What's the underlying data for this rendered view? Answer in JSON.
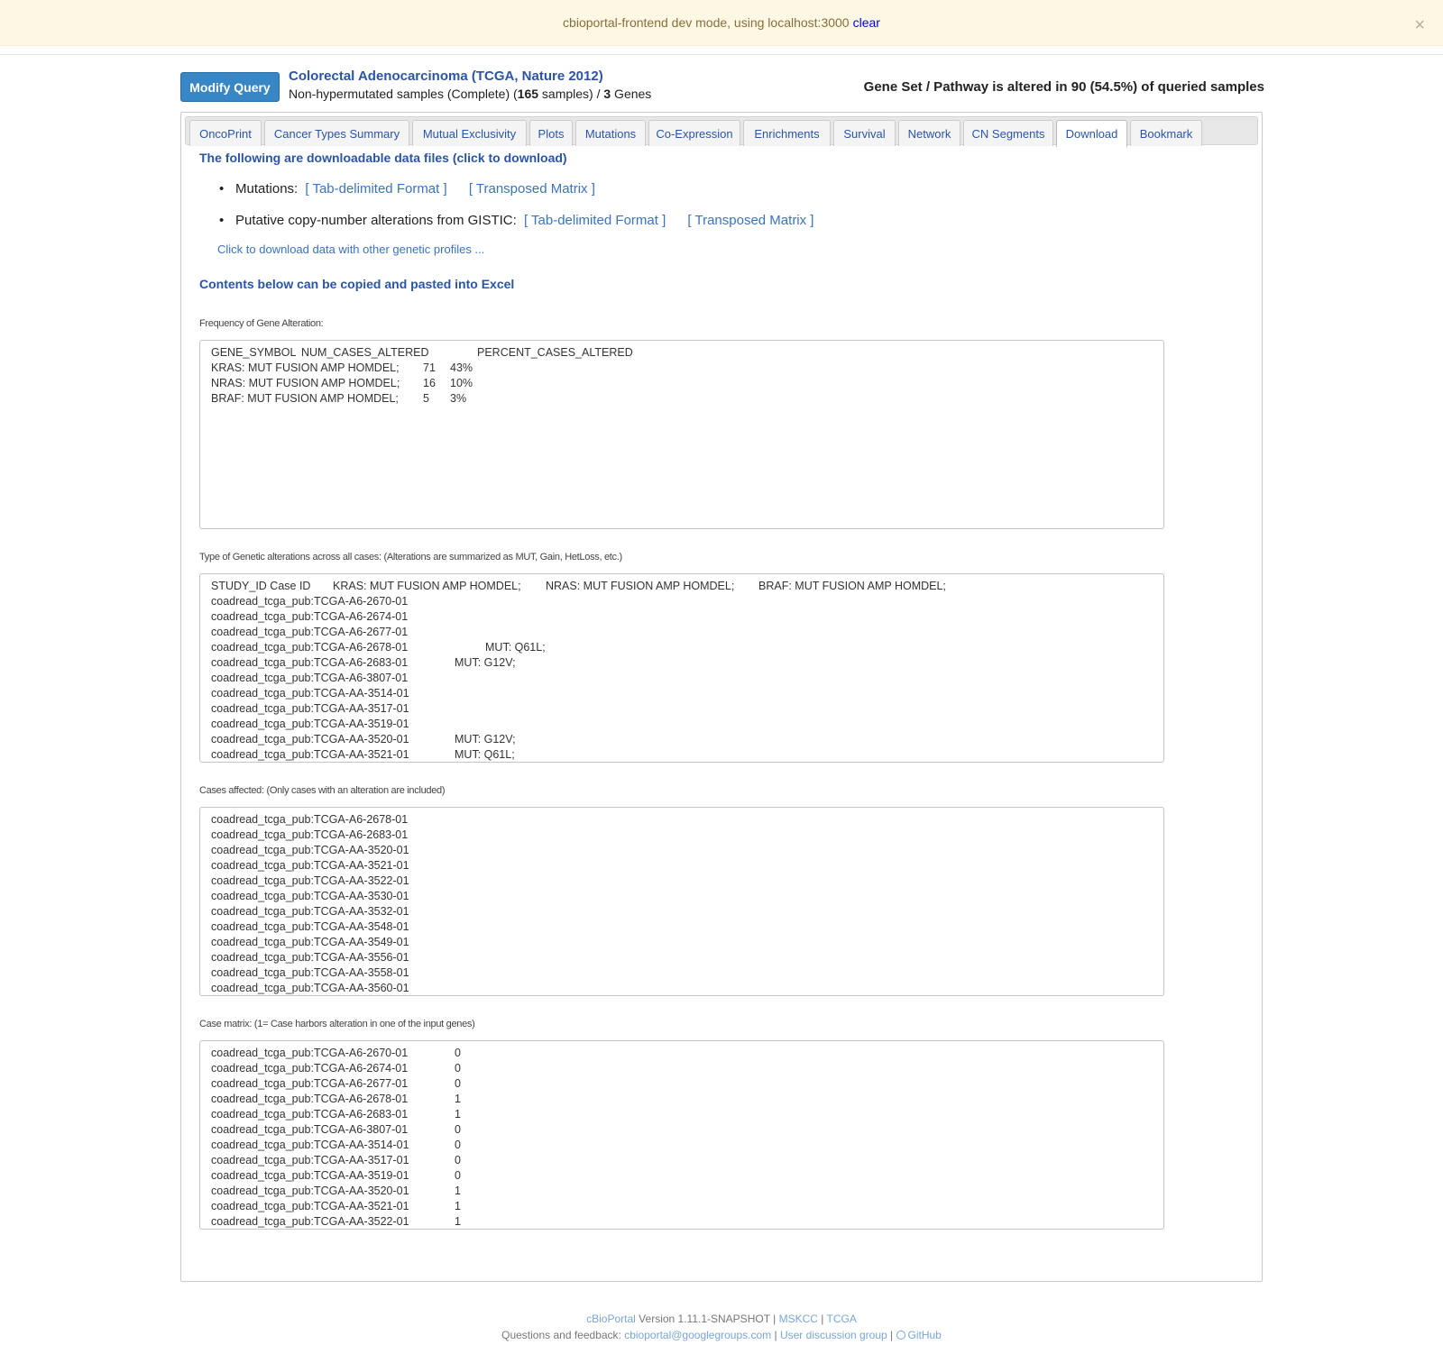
{
  "dev_banner": {
    "text": "cbioportal-frontend dev mode, using localhost:3000",
    "clear_label": "clear",
    "close_symbol": "×"
  },
  "header": {
    "modify_query_label": "Modify Query",
    "study_title": "Colorectal Adenocarcinoma (TCGA, Nature 2012)",
    "study_sub_prefix": "Non-hypermutated samples (Complete)  (",
    "sample_count": "165",
    "study_sub_middle": " samples) / ",
    "gene_count": "3",
    "study_sub_suffix": " Genes",
    "altered_summary": "Gene Set / Pathway is altered in 90 (54.5%) of queried samples"
  },
  "tabs": [
    {
      "label": "OncoPrint"
    },
    {
      "label": "Cancer Types Summary"
    },
    {
      "label": "Mutual Exclusivity"
    },
    {
      "label": "Plots"
    },
    {
      "label": "Mutations"
    },
    {
      "label": "Co-Expression"
    },
    {
      "label": "Enrichments"
    },
    {
      "label": "Survival"
    },
    {
      "label": "Network"
    },
    {
      "label": "CN Segments"
    },
    {
      "label": "Download",
      "active": true
    },
    {
      "label": "Bookmark"
    }
  ],
  "downloads": {
    "title": "The following are downloadable data files (click to download)",
    "items": [
      {
        "label": "Mutations:",
        "tab_link": "[ Tab-delimited Format ]",
        "matrix_link": "[ Transposed Matrix ]"
      },
      {
        "label": "Putative copy-number alterations from GISTIC:",
        "tab_link": "[ Tab-delimited Format ]",
        "matrix_link": "[ Transposed Matrix ]"
      }
    ],
    "other_profiles_link": "Click to download data with other genetic profiles ..."
  },
  "excel": {
    "title": "Contents below can be copied and pasted into Excel",
    "frequency": {
      "label": "Frequency of Gene Alteration:",
      "header": [
        "GENE_SYMBOL",
        "NUM_CASES_ALTERED",
        "PERCENT_CASES_ALTERED"
      ],
      "rows": [
        [
          "KRAS: MUT FUSION AMP HOMDEL;",
          "71",
          "43%"
        ],
        [
          "NRAS: MUT FUSION AMP HOMDEL;",
          "16",
          "10%"
        ],
        [
          "BRAF: MUT FUSION AMP HOMDEL;",
          "5",
          "3%"
        ]
      ]
    },
    "alteration_types": {
      "label": "Type of Genetic alterations across all cases: (Alterations are summarized as MUT, Gain, HetLoss, etc.)",
      "header": [
        "STUDY_ID Case ID",
        "KRAS: MUT FUSION AMP HOMDEL;",
        "NRAS: MUT FUSION AMP HOMDEL;",
        "BRAF: MUT FUSION AMP HOMDEL;"
      ],
      "rows": [
        [
          "coadread_tcga_pub:TCGA-A6-2670-01",
          "",
          "",
          ""
        ],
        [
          "coadread_tcga_pub:TCGA-A6-2674-01",
          "",
          "",
          ""
        ],
        [
          "coadread_tcga_pub:TCGA-A6-2677-01",
          "",
          "",
          ""
        ],
        [
          "coadread_tcga_pub:TCGA-A6-2678-01",
          "",
          "MUT: Q61L;",
          ""
        ],
        [
          "coadread_tcga_pub:TCGA-A6-2683-01",
          "MUT: G12V;",
          "",
          ""
        ],
        [
          "coadread_tcga_pub:TCGA-A6-3807-01",
          "",
          "",
          ""
        ],
        [
          "coadread_tcga_pub:TCGA-AA-3514-01",
          "",
          "",
          ""
        ],
        [
          "coadread_tcga_pub:TCGA-AA-3517-01",
          "",
          "",
          ""
        ],
        [
          "coadread_tcga_pub:TCGA-AA-3519-01",
          "",
          "",
          ""
        ],
        [
          "coadread_tcga_pub:TCGA-AA-3520-01",
          "MUT: G12V;",
          "",
          ""
        ],
        [
          "coadread_tcga_pub:TCGA-AA-3521-01",
          "MUT: Q61L;",
          "",
          ""
        ]
      ]
    },
    "cases_affected": {
      "label": "Cases affected: (Only cases with an alteration are included)",
      "rows": [
        "coadread_tcga_pub:TCGA-A6-2678-01",
        "coadread_tcga_pub:TCGA-A6-2683-01",
        "coadread_tcga_pub:TCGA-AA-3520-01",
        "coadread_tcga_pub:TCGA-AA-3521-01",
        "coadread_tcga_pub:TCGA-AA-3522-01",
        "coadread_tcga_pub:TCGA-AA-3530-01",
        "coadread_tcga_pub:TCGA-AA-3532-01",
        "coadread_tcga_pub:TCGA-AA-3548-01",
        "coadread_tcga_pub:TCGA-AA-3549-01",
        "coadread_tcga_pub:TCGA-AA-3556-01",
        "coadread_tcga_pub:TCGA-AA-3558-01",
        "coadread_tcga_pub:TCGA-AA-3560-01"
      ]
    },
    "case_matrix": {
      "label": "Case matrix: (1= Case harbors alteration in one of the input genes)",
      "rows": [
        [
          "coadread_tcga_pub:TCGA-A6-2670-01",
          "0"
        ],
        [
          "coadread_tcga_pub:TCGA-A6-2674-01",
          "0"
        ],
        [
          "coadread_tcga_pub:TCGA-A6-2677-01",
          "0"
        ],
        [
          "coadread_tcga_pub:TCGA-A6-2678-01",
          "1"
        ],
        [
          "coadread_tcga_pub:TCGA-A6-2683-01",
          "1"
        ],
        [
          "coadread_tcga_pub:TCGA-A6-3807-01",
          "0"
        ],
        [
          "coadread_tcga_pub:TCGA-AA-3514-01",
          "0"
        ],
        [
          "coadread_tcga_pub:TCGA-AA-3517-01",
          "0"
        ],
        [
          "coadread_tcga_pub:TCGA-AA-3519-01",
          "0"
        ],
        [
          "coadread_tcga_pub:TCGA-AA-3520-01",
          "1"
        ],
        [
          "coadread_tcga_pub:TCGA-AA-3521-01",
          "1"
        ],
        [
          "coadread_tcga_pub:TCGA-AA-3522-01",
          "1"
        ]
      ]
    }
  },
  "footer": {
    "cbioportal_link": "cBioPortal",
    "version_text": " Version 1.11.1-SNAPSHOT | ",
    "mskcc_link": "MSKCC",
    "sep1": " | ",
    "tcga_link": "TCGA",
    "feedback_prefix": "Questions and feedback: ",
    "email_link": "cbioportal@googlegroups.com",
    "sep2": " | ",
    "group_link": "User discussion group",
    "sep3": " | ",
    "github_link": "GitHub"
  },
  "colors": {
    "link": "#2a55a7",
    "button": "#3786c6",
    "banner_bg": "#fcf8e3"
  }
}
